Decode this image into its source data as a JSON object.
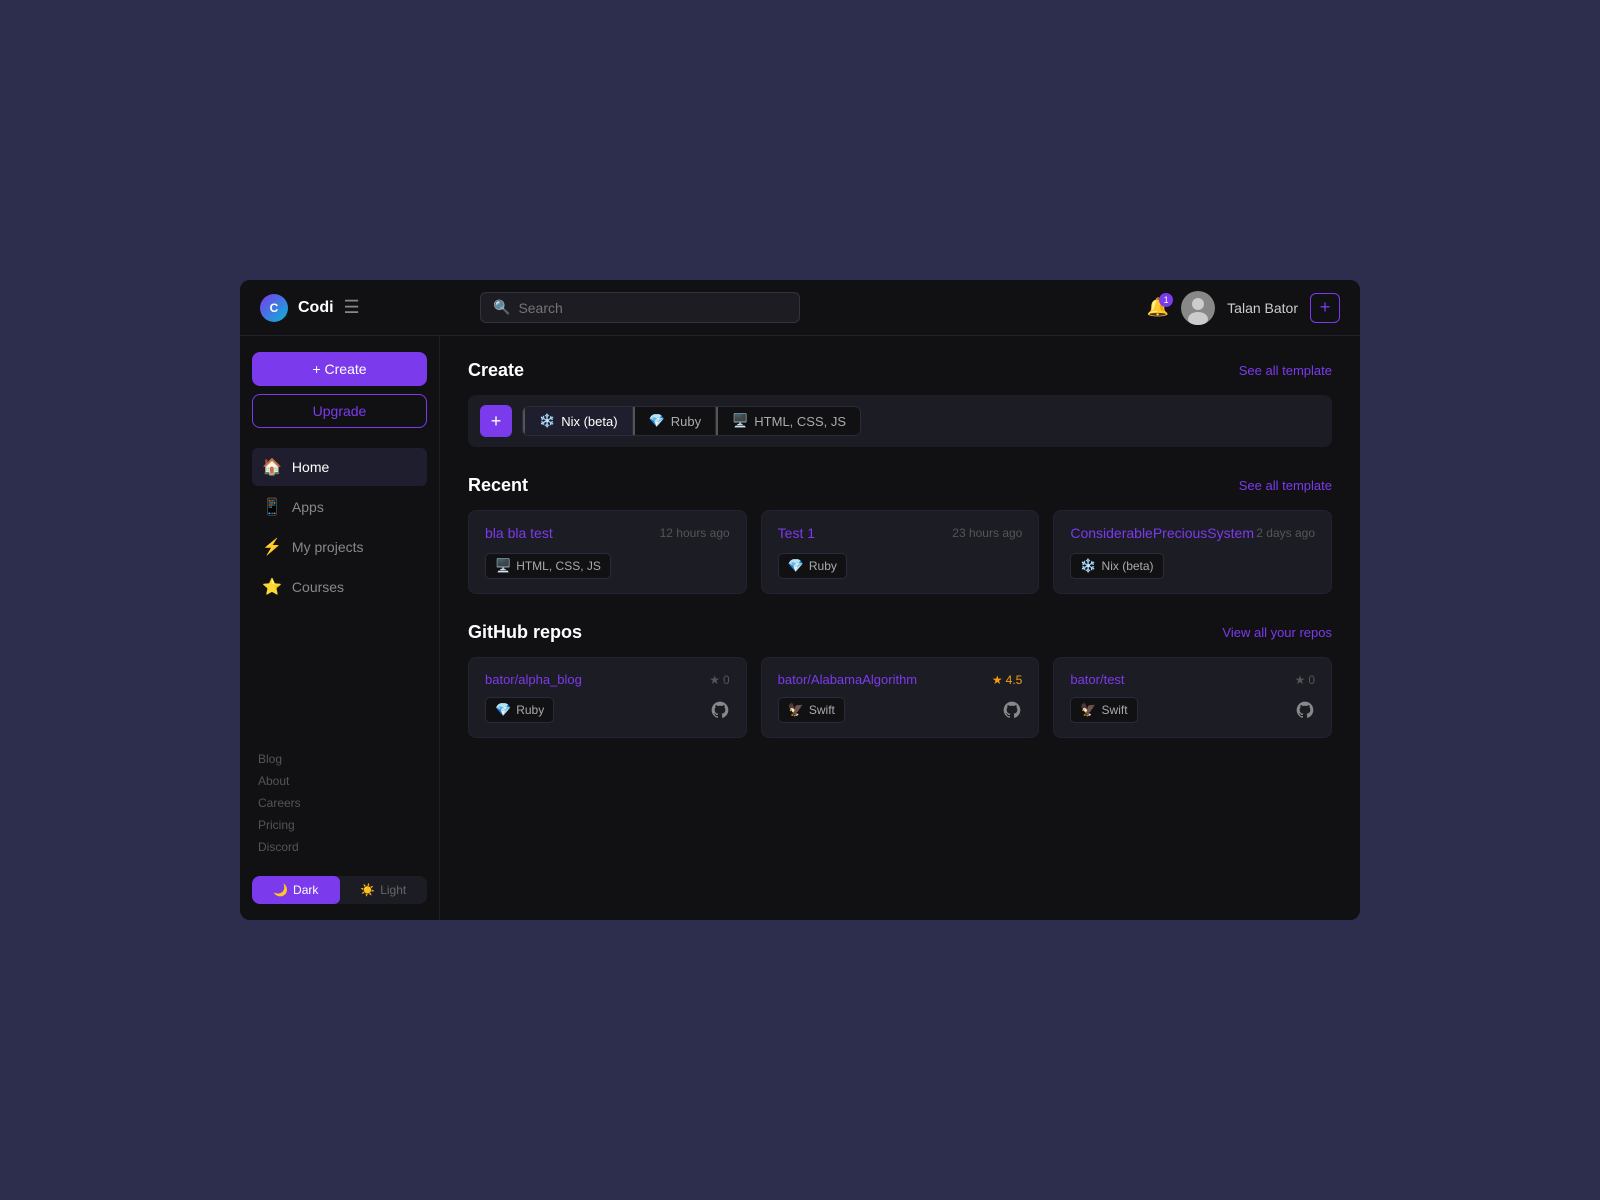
{
  "app": {
    "name": "Codi",
    "logo_text": "Codi"
  },
  "header": {
    "search_placeholder": "Search",
    "user_name": "Talan Bator",
    "notif_count": "1",
    "plus_label": "+"
  },
  "sidebar": {
    "create_label": "+ Create",
    "upgrade_label": "Upgrade",
    "nav_items": [
      {
        "label": "Home",
        "icon": "🏠",
        "active": true
      },
      {
        "label": "Apps",
        "icon": "📱",
        "active": false
      },
      {
        "label": "My projects",
        "icon": "⚡",
        "active": false
      },
      {
        "label": "Courses",
        "icon": "⭐",
        "active": false
      }
    ],
    "footer_links": [
      "Blog",
      "About",
      "Careers",
      "Pricing",
      "Discord"
    ],
    "theme": {
      "dark_label": "Dark",
      "light_label": "Light"
    }
  },
  "create_section": {
    "title": "Create",
    "see_all": "See all template",
    "templates": [
      {
        "label": "Nix (beta)",
        "emoji": "❄️"
      },
      {
        "label": "Ruby",
        "emoji": "💎"
      },
      {
        "label": "HTML, CSS, JS",
        "emoji": "🖥️"
      }
    ]
  },
  "recent_section": {
    "title": "Recent",
    "see_all": "See all template",
    "items": [
      {
        "name": "bla bla test",
        "time": "12 hours ago",
        "tag_label": "HTML, CSS, JS",
        "tag_emoji": "🖥️"
      },
      {
        "name": "Test 1",
        "time": "23 hours ago",
        "tag_label": "Ruby",
        "tag_emoji": "💎"
      },
      {
        "name": "ConsiderablePreciousSystem",
        "time": "2 days ago",
        "tag_label": "Nix (beta)",
        "tag_emoji": "❄️"
      }
    ]
  },
  "github_section": {
    "title": "GitHub repos",
    "view_all": "View all your repos",
    "repos": [
      {
        "name": "bator/alpha_blog",
        "stars": "0",
        "tag_label": "Ruby",
        "tag_emoji": "💎"
      },
      {
        "name": "bator/AlabamaAlgorithm",
        "stars": "4.5",
        "star_colored": true,
        "tag_label": "Swift",
        "tag_emoji": "🦅"
      },
      {
        "name": "bator/test",
        "stars": "0",
        "tag_label": "Swift",
        "tag_emoji": "🦅"
      }
    ]
  }
}
